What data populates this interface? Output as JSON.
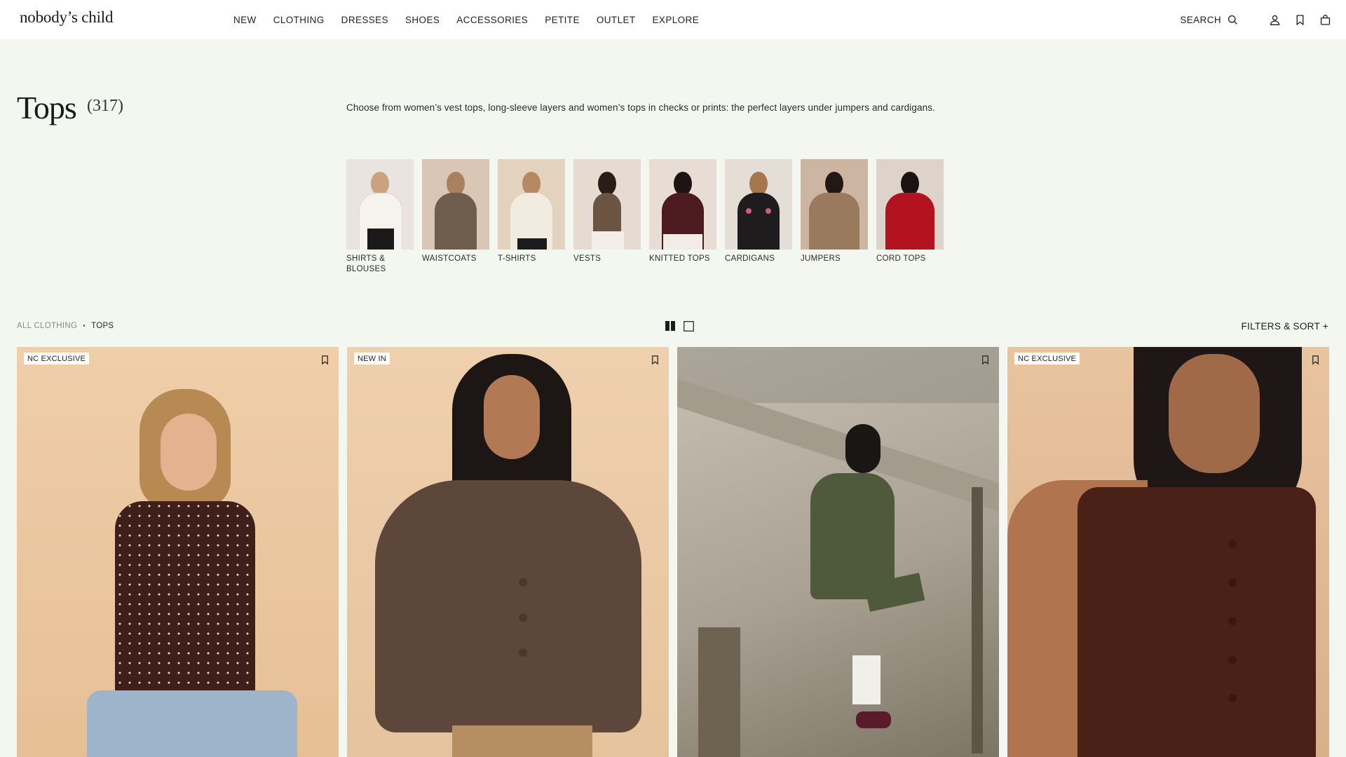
{
  "brand": {
    "logo_text": "nobody’s child"
  },
  "nav": {
    "items": [
      "NEW",
      "CLOTHING",
      "DRESSES",
      "SHOES",
      "ACCESSORIES",
      "PETITE",
      "OUTLET",
      "EXPLORE"
    ]
  },
  "header_actions": {
    "search_label": "SEARCH",
    "icons": [
      "search-icon",
      "account-icon",
      "bookmark-icon",
      "bag-icon"
    ]
  },
  "page": {
    "title": "Tops",
    "count": "(317)",
    "description": "Choose from women’s vest tops, long-sleeve layers and women’s tops in checks or prints: the perfect layers under jumpers and cardigans."
  },
  "subcategories": [
    {
      "label": "SHIRTS & BLOUSES",
      "tone": "#e9e4df",
      "garment": "#f3f0ec"
    },
    {
      "label": "WAISTCOATS",
      "tone": "#d9c6b4",
      "garment": "#6e5d4c"
    },
    {
      "label": "T-SHIRTS",
      "tone": "#e2d2be",
      "garment": "#f2ece0"
    },
    {
      "label": "VESTS",
      "tone": "#e6dbd0",
      "garment": "#6c5443"
    },
    {
      "label": "KNITTED TOPS",
      "tone": "#e7ddd4",
      "garment": "#4b1b20"
    },
    {
      "label": "CARDIGANS",
      "tone": "#e5ded6",
      "garment": "#1e1c1c"
    },
    {
      "label": "JUMPERS",
      "tone": "#cdb6a1",
      "garment": "#9a7a5d"
    },
    {
      "label": "CORD TOPS",
      "tone": "#ddd3cb",
      "garment": "#b3131f"
    }
  ],
  "toolbar": {
    "breadcrumb_parent": "ALL CLOTHING",
    "breadcrumb_separator": "•",
    "breadcrumb_current": "TOPS",
    "view_options": [
      "two-column-grid-icon",
      "single-column-grid-icon"
    ],
    "filters_label": "FILTERS & SORT +"
  },
  "products": [
    {
      "badge": "NC EXCLUSIVE",
      "bg": "#ecc9a3",
      "garment": "#3f1f1a"
    },
    {
      "badge": "NEW IN",
      "bg": "#eccaa6",
      "garment": "#5c473a"
    },
    {
      "badge": "",
      "bg": "#b9b2a4",
      "garment": "#4f5a3c"
    },
    {
      "badge": "NC EXCLUSIVE",
      "bg": "#e3bc94",
      "garment": "#4a2117"
    }
  ],
  "colors": {
    "page_bg": "#f4f6f0",
    "header_bg": "#ffffff",
    "text": "#1b1b1b",
    "muted": "#8a8a8a"
  }
}
